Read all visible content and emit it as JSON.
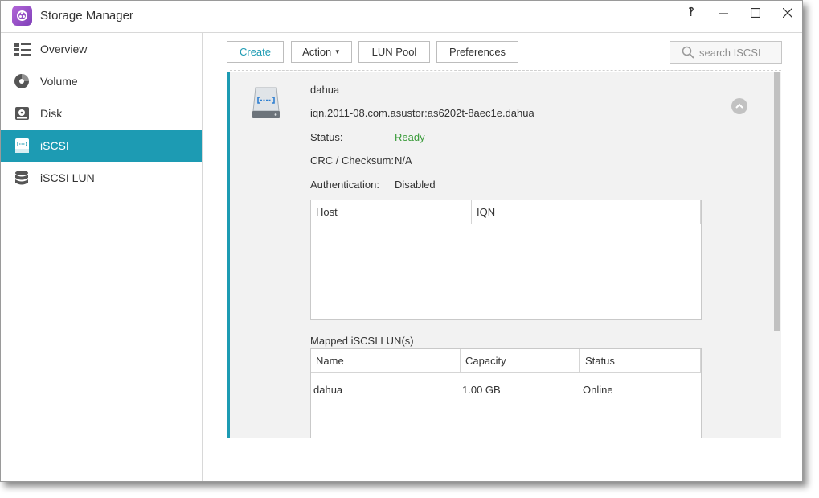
{
  "window": {
    "title": "Storage Manager",
    "help_glyph": "‽"
  },
  "sidebar": {
    "items": [
      {
        "label": "Overview",
        "icon": "overview-list-icon"
      },
      {
        "label": "Volume",
        "icon": "volume-disc-icon"
      },
      {
        "label": "Disk",
        "icon": "disk-drive-icon"
      },
      {
        "label": "iSCSI",
        "icon": "iscsi-target-icon",
        "active": true
      },
      {
        "label": "iSCSI LUN",
        "icon": "iscsi-lun-stack-icon"
      }
    ]
  },
  "toolbar": {
    "create": "Create",
    "action": "Action",
    "lun_pool": "LUN Pool",
    "preferences": "Preferences",
    "search_placeholder": "search ISCSI"
  },
  "target": {
    "name": "dahua",
    "iqn": "iqn.2011-08.com.asustor:as6202t-8aec1e.dahua",
    "status_label": "Status:",
    "status_value": "Ready",
    "crc_label": "CRC / Checksum:",
    "crc_value": "N/A",
    "auth_label": "Authentication:",
    "auth_value": "Disabled"
  },
  "host_table": {
    "headers": [
      "Host",
      "IQN"
    ],
    "rows": []
  },
  "lun_section": {
    "title": "Mapped iSCSI LUN(s)",
    "headers": [
      "Name",
      "Capacity",
      "Status"
    ],
    "rows": [
      {
        "name": "dahua",
        "capacity": "1.00 GB",
        "status": "Online"
      }
    ]
  },
  "colors": {
    "accent": "#1d9bb3",
    "ready": "#3a9b3a",
    "app_icon": "#9b4fcf"
  }
}
